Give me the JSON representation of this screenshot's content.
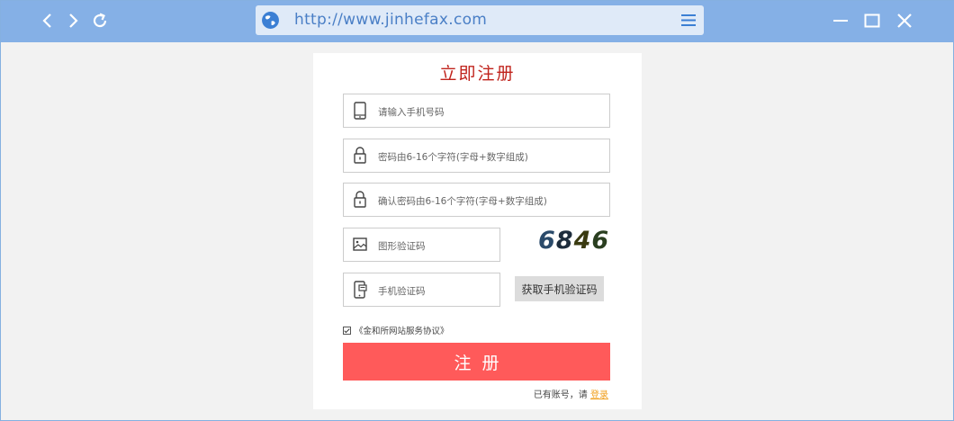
{
  "browser": {
    "url": "http://www.jinhefax.com",
    "icons": [
      "back-icon",
      "forward-icon",
      "refresh-icon",
      "globe-icon",
      "menu-icon",
      "minimize-icon",
      "maximize-icon",
      "close-icon"
    ]
  },
  "form": {
    "title": "立即注册",
    "phone_placeholder": "请输入手机号码",
    "password_placeholder": "密码由6-16个字符(字母+数字组成)",
    "confirm_placeholder": "确认密码由6-16个字符(字母+数字组成)",
    "captcha_placeholder": "图形验证码",
    "captcha_value": "6846",
    "sms_placeholder": "手机验证码",
    "sms_button": "获取手机验证码",
    "agreement": "《金和所网站服务协议》",
    "agreement_checked": true,
    "register_button": "注册",
    "login_prompt": "已有账号，请",
    "login_link": "登录"
  },
  "colors": {
    "titlebar": "#85b0e6",
    "title": "#c0231c",
    "register": "#ff5a5a",
    "login_link": "#f0a020"
  }
}
